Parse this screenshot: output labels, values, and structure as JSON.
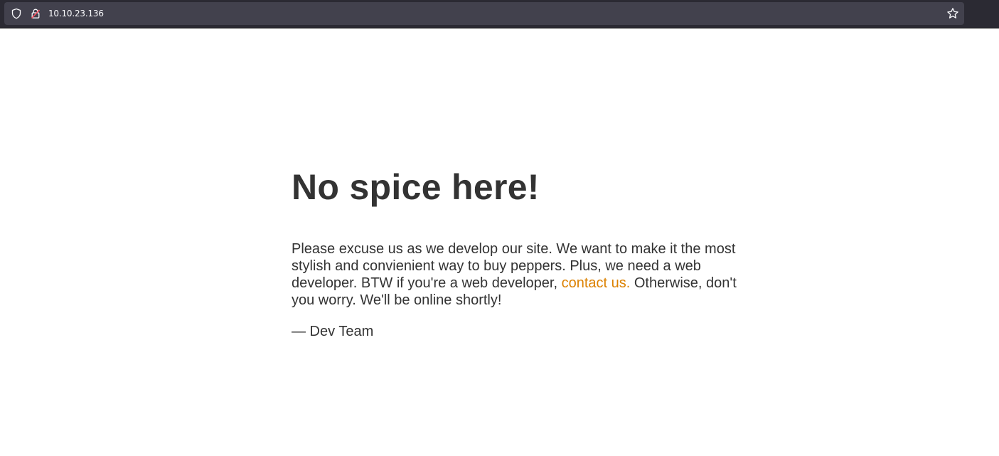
{
  "browser": {
    "url": "10.10.23.136",
    "icons": {
      "shield": "shield-icon",
      "lock": "insecure-lock-icon",
      "bookmark": "star-icon"
    }
  },
  "page": {
    "title": "No spice here!",
    "message_before_link": "Please excuse us as we develop our site. We want to make it the most stylish and convienient way to buy peppers. Plus, we need a web developer. BTW if you're a web developer, ",
    "link_text": "contact us.",
    "message_after_link": " Otherwise, don't you worry. We'll be online shortly!",
    "signature": "— Dev Team"
  },
  "colors": {
    "text": "#333333",
    "link": "#dc8100",
    "toolbar": "#2b2a33",
    "url_field": "#42414d"
  }
}
